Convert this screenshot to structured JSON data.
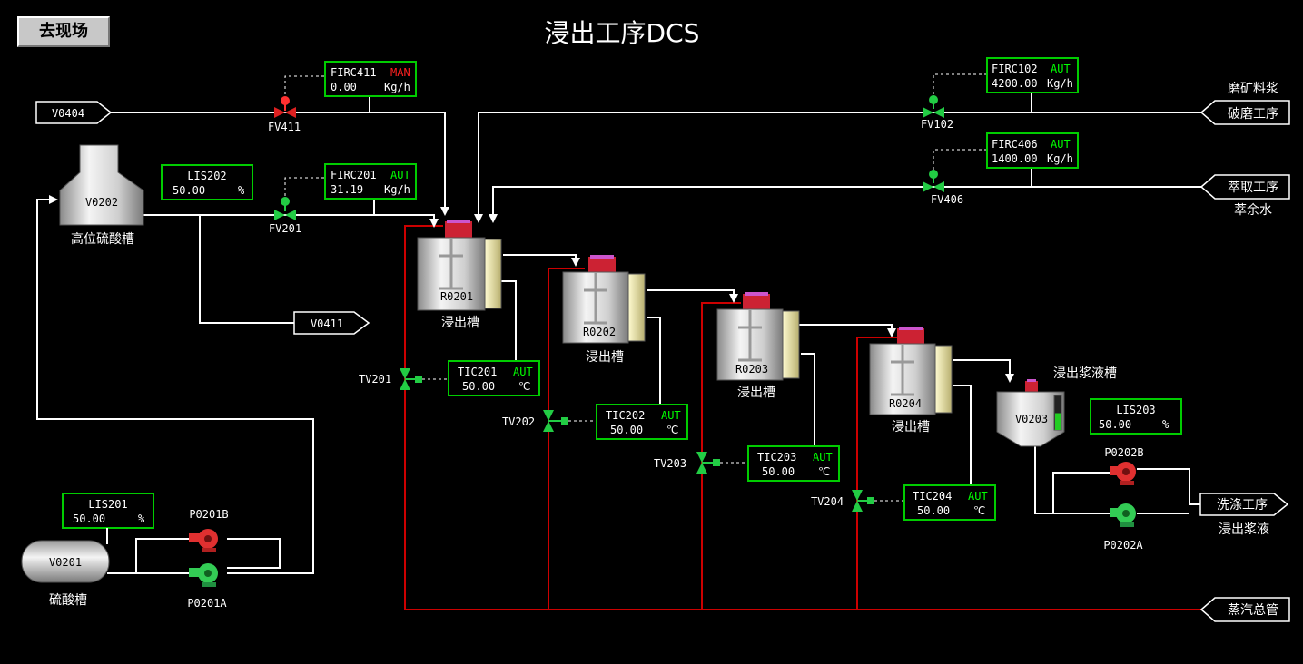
{
  "title": "浸出工序DCS",
  "goto_button": "去现场",
  "status": {
    "aut": "AUT",
    "man": "MAN"
  },
  "colors": {
    "pipe": "#ffffff",
    "steam": "#cc0000",
    "box": "#00cc00",
    "aut": "#00ff00",
    "man": "#ff2020",
    "valve": "#00cc44",
    "pump_run": "#33cc55",
    "pump_stop": "#e03030"
  },
  "controllers": {
    "firc411": {
      "tag": "FIRC411",
      "mode": "MAN",
      "value": "0.00",
      "unit": "Kg/h"
    },
    "firc201": {
      "tag": "FIRC201",
      "mode": "AUT",
      "value": "31.19",
      "unit": "Kg/h"
    },
    "firc102": {
      "tag": "FIRC102",
      "mode": "AUT",
      "value": "4200.00",
      "unit": "Kg/h"
    },
    "firc406": {
      "tag": "FIRC406",
      "mode": "AUT",
      "value": "1400.00",
      "unit": "Kg/h"
    },
    "lis202": {
      "tag": "LIS202",
      "value": "50.00",
      "unit": "%"
    },
    "lis201": {
      "tag": "LIS201",
      "value": "50.00",
      "unit": "%"
    },
    "lis203": {
      "tag": "LIS203",
      "value": "50.00",
      "unit": "%"
    },
    "tic201": {
      "tag": "TIC201",
      "mode": "AUT",
      "value": "50.00",
      "unit": "℃"
    },
    "tic202": {
      "tag": "TIC202",
      "mode": "AUT",
      "value": "50.00",
      "unit": "℃"
    },
    "tic203": {
      "tag": "TIC203",
      "mode": "AUT",
      "value": "50.00",
      "unit": "℃"
    },
    "tic204": {
      "tag": "TIC204",
      "mode": "AUT",
      "value": "50.00",
      "unit": "℃"
    }
  },
  "valves": {
    "fv411": "FV411",
    "fv201": "FV201",
    "fv102": "FV102",
    "fv406": "FV406",
    "tv201": "TV201",
    "tv202": "TV202",
    "tv203": "TV203",
    "tv204": "TV204"
  },
  "vessels": {
    "v0202": {
      "tag": "V0202",
      "name": "高位硫酸槽"
    },
    "v0201": {
      "tag": "V0201",
      "name": "硫酸槽"
    },
    "r0201": {
      "tag": "R0201",
      "name": "浸出槽"
    },
    "r0202": {
      "tag": "R0202",
      "name": "浸出槽"
    },
    "r0203": {
      "tag": "R0203",
      "name": "浸出槽"
    },
    "r0204": {
      "tag": "R0204",
      "name": "浸出槽"
    },
    "v0203": {
      "tag": "V0203",
      "name": "浸出浆液槽",
      "level": 0.5
    }
  },
  "pumps": {
    "p0201b": "P0201B",
    "p0201a": "P0201A",
    "p0202b": "P0202B",
    "p0202a": "P0202A"
  },
  "connectors": {
    "v0404": "V0404",
    "v0411": "V0411",
    "mill": "破磨工序",
    "mill_note": "磨矿料浆",
    "extract": "萃取工序",
    "extract_note": "萃余水",
    "wash": "洗涤工序",
    "wash_note": "浸出浆液",
    "steam": "蒸汽总管"
  }
}
